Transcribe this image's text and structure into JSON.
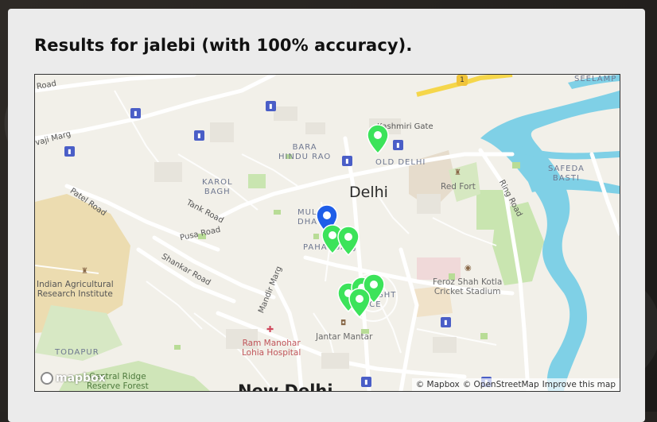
{
  "page": {
    "title": "Results for jalebi (with 100% accuracy)."
  },
  "map": {
    "labels": {
      "road_top_left": "Road",
      "kashmiri_gate": "Kashmiri Gate",
      "seelampur": "SEELAMP",
      "bara_hindu_rao": "BARA\nHINDU RAO",
      "old_delhi": "OLD DELHI",
      "safeda_basti": "SAFEDA\nBASTI",
      "karol_bagh": "KAROL\nBAGH",
      "delhi": "Delhi",
      "red_fort": "Red Fort",
      "ring_road": "Ring Road",
      "patel_road": "Patel Road",
      "tank_road": "Tank Road",
      "multani_dhanda": "MUL\nDHA",
      "pusa_road": "Pusa Road",
      "paharganj": "PAHARGANJ",
      "shankar_road": "Shankar Road",
      "vaji_marg": "vaji Marg",
      "indian_agri": "Indian Agricultural\nResearch Institute",
      "mandir_marg": "Mandir Marg",
      "connaught_place": "CONNAUGHT\nPLACE",
      "feroz_shah": "Feroz Shah Kotla\nCricket Stadium",
      "jantar_mantar": "Jantar Mantar",
      "ram_manohar": "Ram Manohar\nLohia Hospital",
      "todapur": "TODAPUR",
      "central_ridge": "Central Ridge\nReserve Forest",
      "new_delhi": "New Delhi"
    },
    "logo_text": "mapbox",
    "attribution": {
      "mapbox": "© Mapbox",
      "osm": "© OpenStreetMap",
      "improve": "Improve this map"
    },
    "colors": {
      "result_marker": "#3ce35a",
      "user_marker": "#1f5ee8",
      "water": "#7fd0e6",
      "park": "#c9e5b0"
    }
  }
}
